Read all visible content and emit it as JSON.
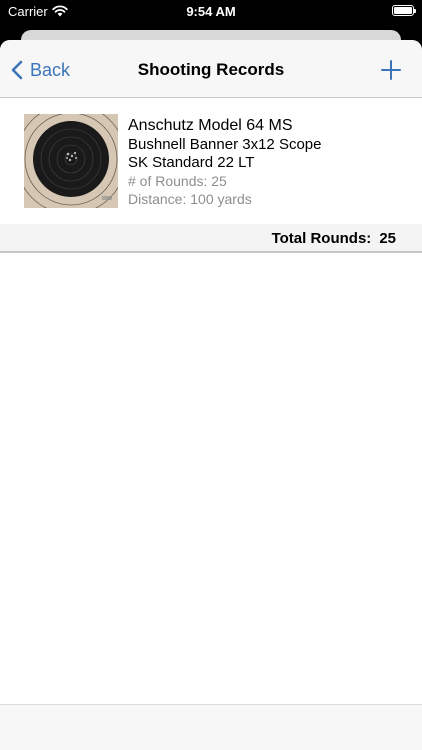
{
  "status_bar": {
    "carrier": "Carrier",
    "time": "9:54 AM"
  },
  "nav": {
    "back_label": "Back",
    "title": "Shooting Records"
  },
  "records": [
    {
      "rifle": "Anschutz Model 64 MS",
      "scope": "Bushnell Banner 3x12 Scope",
      "ammo": "SK Standard 22 LT",
      "rounds": "# of Rounds: 25",
      "distance": "Distance: 100 yards"
    }
  ],
  "summary": {
    "total_label": "Total Rounds:",
    "total_value": "25"
  },
  "colors": {
    "tint": "#3b74b8"
  }
}
